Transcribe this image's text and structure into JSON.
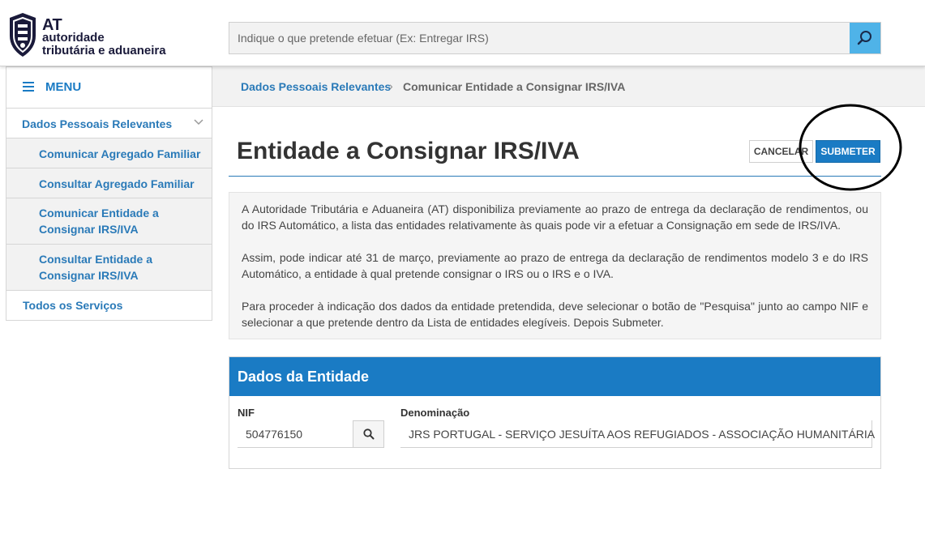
{
  "brand": {
    "short": "AT",
    "line1": "autoridade",
    "line2": "tributária e aduaneira"
  },
  "search": {
    "placeholder": "Indique o que pretende efetuar (Ex: Entregar IRS)",
    "icon": "search-icon"
  },
  "breadcrumb": {
    "items": [
      {
        "label": "Dados Pessoais Relevantes"
      },
      {
        "label": "Comunicar Entidade a Consignar IRS/IVA"
      }
    ],
    "separator": "›"
  },
  "sidebar": {
    "menu_label": "MENU",
    "section_label": "Dados Pessoais Relevantes",
    "items": [
      {
        "label": "Comunicar Agregado Familiar"
      },
      {
        "label": "Consultar Agregado Familiar"
      },
      {
        "line1": "Comunicar Entidade a",
        "line2": "Consignar IRS/IVA"
      },
      {
        "line1": "Consultar Entidade a",
        "line2": "Consignar IRS/IVA"
      }
    ],
    "all_services": "Todos os Serviços"
  },
  "main": {
    "title": "Entidade a Consignar IRS/IVA",
    "cancel_label": "CANCELAR",
    "submit_label": "SUBMETER",
    "info": [
      "A Autoridade Tributária e Aduaneira (AT) disponibiliza previamente ao prazo de entrega da declaração de rendimentos, ou do IRS Automático, a lista das entidades relativamente às quais pode vir a efetuar a Consignação em sede de IRS/IVA.",
      "Assim, pode indicar até 31 de março, previamente ao prazo de entrega da declaração de rendimentos modelo 3 e do IRS Automático, a entidade à qual pretende consignar o IRS ou o IRS e o IVA.",
      "Para proceder à indicação dos dados da entidade pretendida, deve selecionar o botão de \"Pesquisa\" junto ao campo NIF e selecionar a que pretende dentro da Lista de entidades elegíveis. Depois Submeter."
    ],
    "panel": {
      "title": "Dados da Entidade",
      "nif_label": "NIF",
      "nif_value": "504776150",
      "den_label": "Denominação",
      "den_value": "JRS PORTUGAL - SERVIÇO JESUÍTA AOS REFUGIADOS - ASSOCIAÇÃO HUMANITÁRIA"
    }
  },
  "colors": {
    "accent": "#1a7bc4",
    "link": "#2a7ab8",
    "search_button": "#4fb3e8"
  }
}
